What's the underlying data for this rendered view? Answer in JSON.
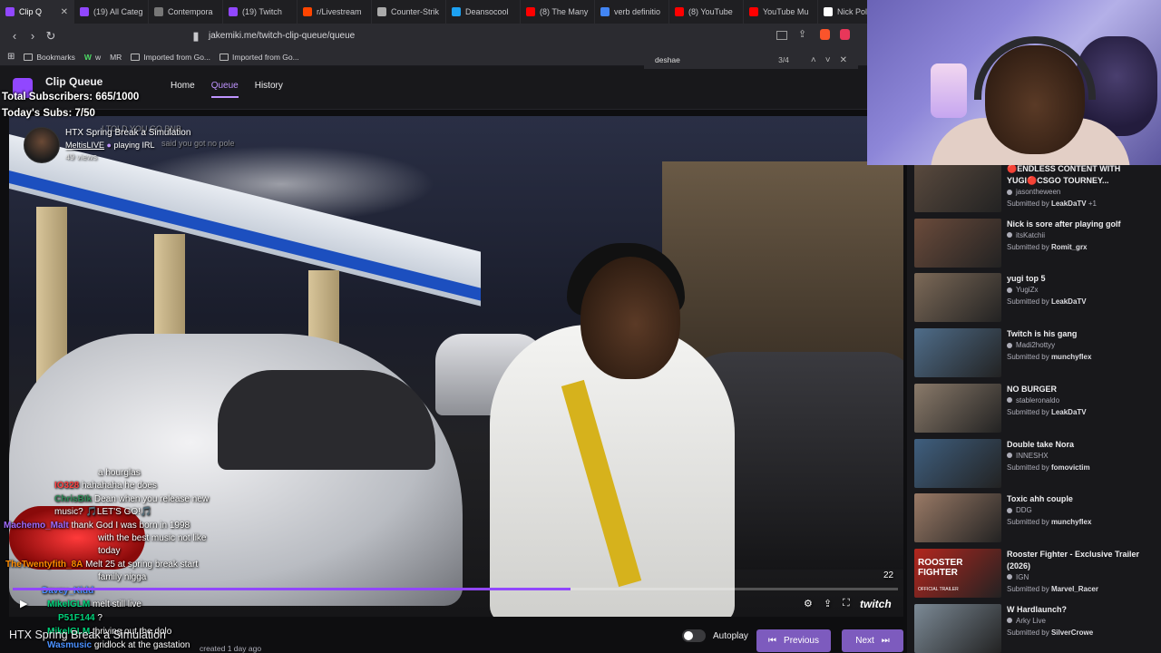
{
  "browser": {
    "tabs": [
      {
        "label": "Clip Q",
        "color": "#9147ff",
        "active": true
      },
      {
        "label": "(19) All Categ",
        "color": "#9147ff"
      },
      {
        "label": "Contempora",
        "color": "#777777"
      },
      {
        "label": "(19) Twitch",
        "color": "#9147ff"
      },
      {
        "label": "r/Livestream",
        "color": "#ff4500"
      },
      {
        "label": "Counter-Strik",
        "color": "#aaaaaa"
      },
      {
        "label": "Deansocool",
        "color": "#1da1f2"
      },
      {
        "label": "(8) The Many",
        "color": "#ff0000"
      },
      {
        "label": "verb definitio",
        "color": "#4285f4"
      },
      {
        "label": "(8) YouTube",
        "color": "#ff0000"
      },
      {
        "label": "YouTube Mu",
        "color": "#ff0000"
      },
      {
        "label": "Nick Polon",
        "color": "#ffffff"
      }
    ],
    "url": "jakemiki.me/twitch-clip-queue/queue",
    "bookmarks": [
      "Bookmarks",
      "w",
      "MR",
      "Imported from Go...",
      "Imported from Go..."
    ],
    "find": {
      "query": "deshae",
      "count": "3/4"
    }
  },
  "app": {
    "title": "Clip Queue",
    "nav": [
      {
        "label": "Home",
        "active": false
      },
      {
        "label": "Queue",
        "active": true
      },
      {
        "label": "History",
        "active": false
      }
    ]
  },
  "stream_overlay": {
    "total_subs": "Total Subscribers: 665/1000",
    "todays_subs": "Today's Subs: 7/50"
  },
  "clip": {
    "title": "HTX Spring Break a Simulation",
    "channel": "MeltisLIVE",
    "channel_suffix": "playing IRL",
    "views": "49 views",
    "ghost_1": "I TOLD YOU GO BNB",
    "ghost_2": "said you got no pole",
    "progress_fraction": 0.63,
    "time_remaining": "22",
    "brand": "twitch",
    "bottom_title": "HTX Spring Break a Simulation",
    "bottom_meta": "created 1 day ago"
  },
  "chat": [
    {
      "user": "",
      "msg": "a hourglas",
      "user_color": "#ffffff"
    },
    {
      "user": "IO328",
      "msg": "hahahaha he does",
      "user_color": "#ff4040"
    },
    {
      "user": "ChrisBIk",
      "msg": "Dean when you release new",
      "user_color": "#2e8b57"
    },
    {
      "user": "",
      "msg": "music? 🎵LET'S GO!🎵",
      "user_color": "#ffffff"
    },
    {
      "user": "Machemo_Malt",
      "msg": "thank God I was born in 1998",
      "user_color": "#9f6bff"
    },
    {
      "user": "",
      "msg": "with the best music not like",
      "user_color": "#ffffff"
    },
    {
      "user": "",
      "msg": "today",
      "user_color": "#ffffff"
    },
    {
      "user": "TheTwentyfith_8A",
      "msg": "Melt 25 at spring break start",
      "user_color": "#ff8c00"
    },
    {
      "user": "",
      "msg": "family nigga",
      "user_color": "#ffffff"
    },
    {
      "user": "Davey_Kidd",
      "msg": "",
      "user_color": "#4a90ff"
    },
    {
      "user": "MikelGLM",
      "msg": "melt still live",
      "user_color": "#00d27a"
    },
    {
      "user": "P51F144",
      "msg": "?",
      "user_color": "#00d27a"
    },
    {
      "user": "MikelGLM",
      "msg": "thriving out the dolo",
      "user_color": "#00d27a"
    },
    {
      "user": "Wasmusic",
      "msg": "gridlock at the gastation",
      "user_color": "#4a90ff"
    }
  ],
  "controls": {
    "autoplay_label": "Autoplay",
    "previous_label": "Previous",
    "next_label": "Next"
  },
  "queue": [
    {
      "title": "🔴ENDLESS CONTENT WITH YUGI🔴CSGO TOURNEY...",
      "channel": "jasontheween",
      "submitter": "LeakDaTV",
      "extra": "+1",
      "thumb": "#5a4a3e"
    },
    {
      "title": "Nick is sore after playing golf",
      "channel": "itsKatchii",
      "submitter": "Romit_grx",
      "extra": "",
      "thumb": "#6b4b3b"
    },
    {
      "title": "yugi top 5",
      "channel": "YugiZx",
      "submitter": "LeakDaTV",
      "extra": "",
      "thumb": "#7d6a58"
    },
    {
      "title": "Twitch is his gang",
      "channel": "Madi2hottyy",
      "submitter": "munchyflex",
      "extra": "",
      "thumb": "#4f6d8a"
    },
    {
      "title": "NO BURGER",
      "channel": "stableronaldo",
      "submitter": "LeakDaTV",
      "extra": "",
      "thumb": "#8a7a6a"
    },
    {
      "title": "Double take Nora",
      "channel": "INNESHX",
      "submitter": "fomovictim",
      "extra": "",
      "thumb": "#3f5f7f"
    },
    {
      "title": "Toxic ahh couple",
      "channel": "DDG",
      "submitter": "munchyflex",
      "extra": "",
      "thumb": "#9a7a66"
    },
    {
      "title": "Rooster Fighter - Exclusive Trailer (2026)",
      "channel": "IGN",
      "submitter": "Marvel_Racer",
      "extra": "",
      "thumb": "#b3261e"
    },
    {
      "title": "W Hardlaunch?",
      "channel": "Arky Live",
      "submitter": "SilverCrowe",
      "extra": "",
      "thumb": "#7c8a96"
    }
  ],
  "queue_labels": {
    "submitted_by": "Submitted by",
    "rooster_thumb_text": "ROOSTER FIGHTER",
    "rooster_thumb_sub": "OFFICIAL TRAILER"
  }
}
